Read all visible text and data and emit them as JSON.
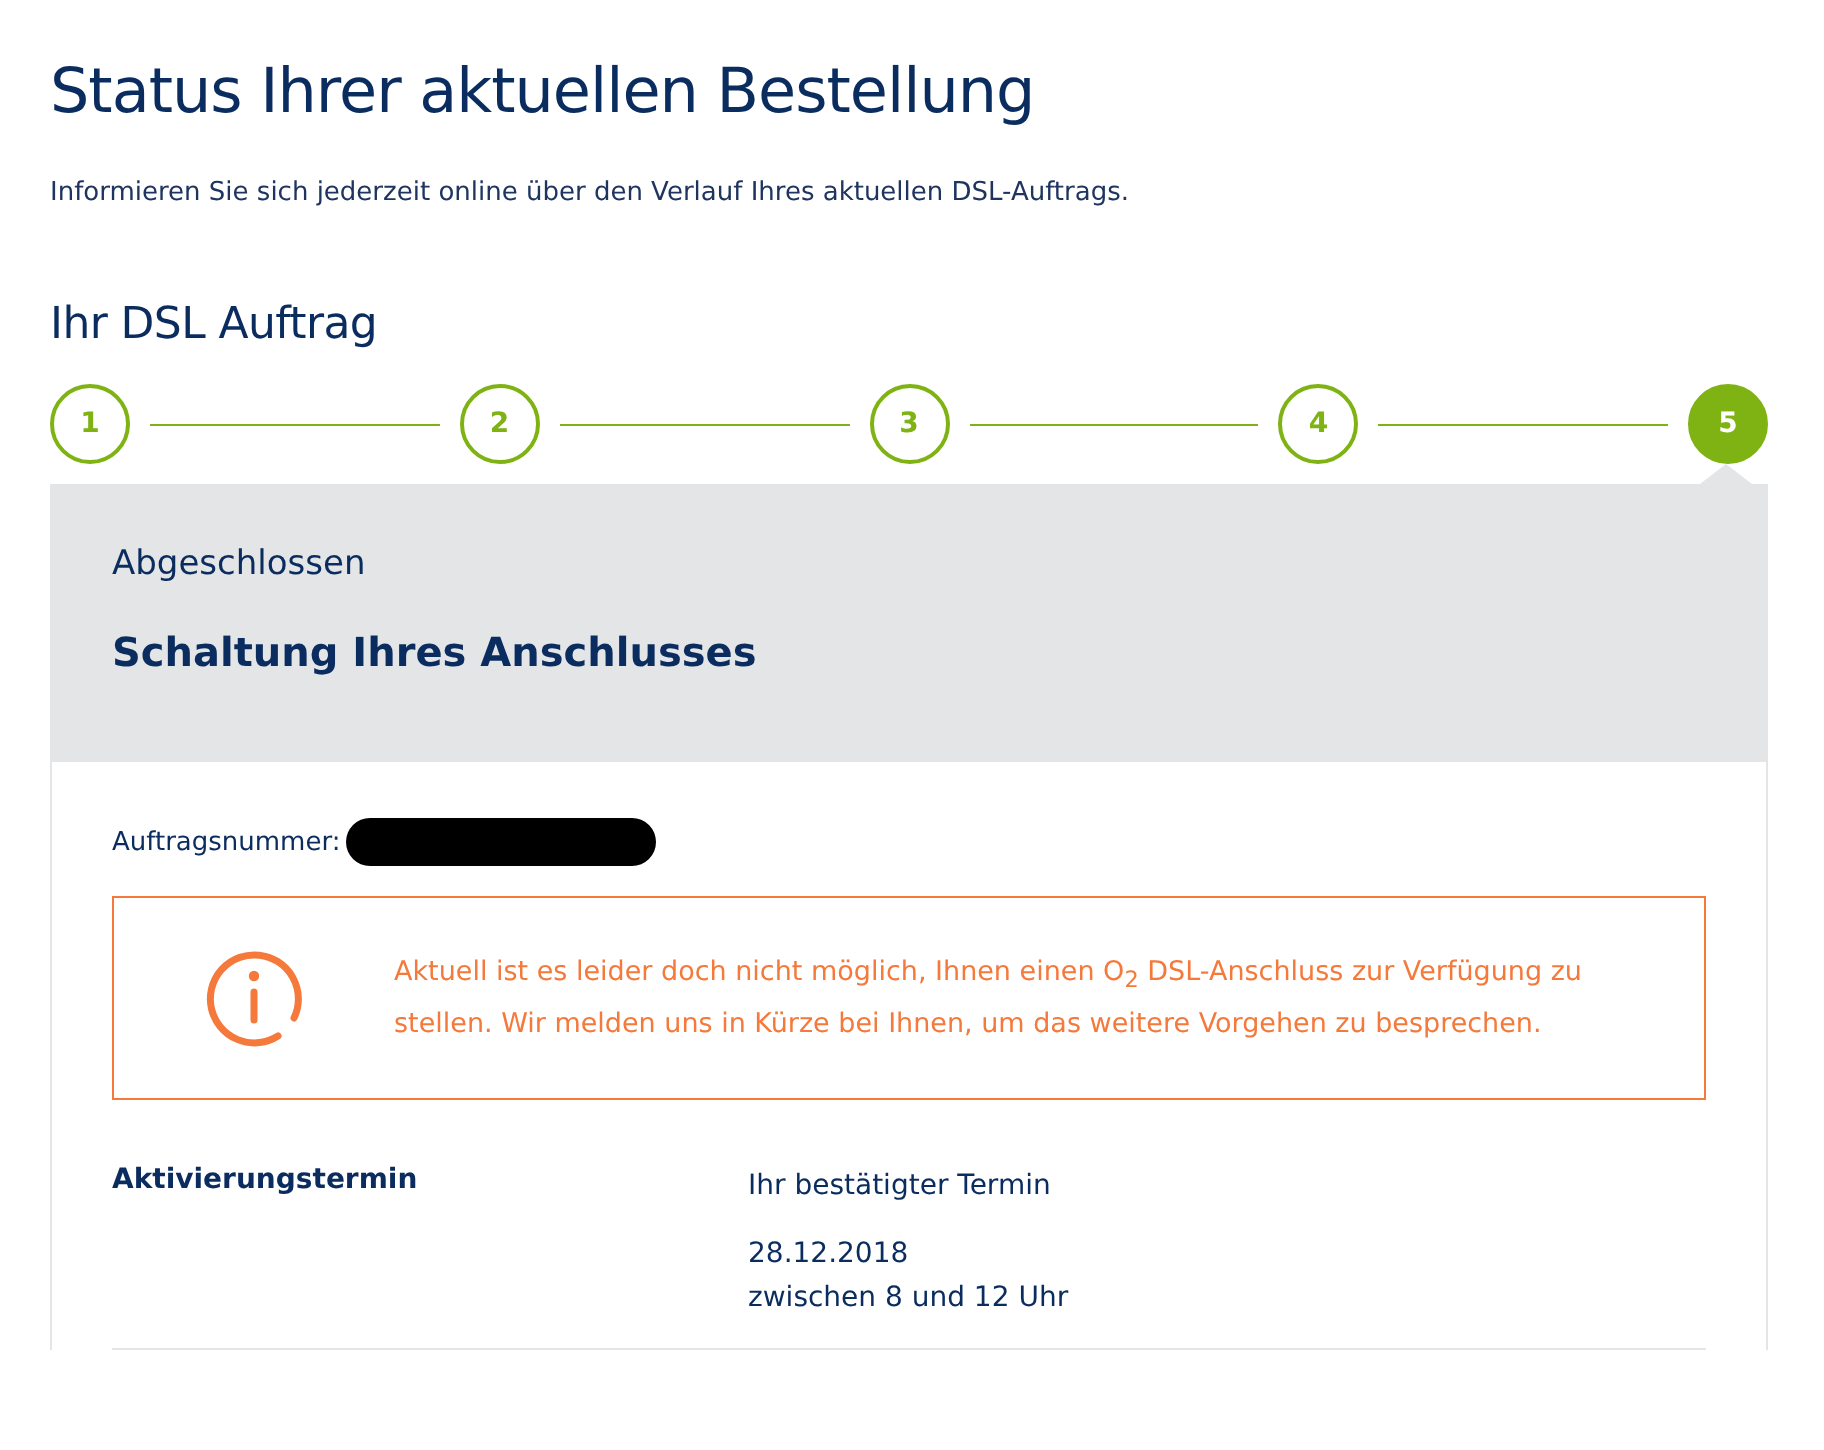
{
  "title": "Status Ihrer aktuellen Bestellung",
  "intro": "Informieren Sie sich jederzeit online über den Verlauf Ihres aktuellen DSL-Auftrags.",
  "section_title": "Ihr DSL Auftrag",
  "steps": [
    {
      "label": "1",
      "selected": false
    },
    {
      "label": "2",
      "selected": false
    },
    {
      "label": "3",
      "selected": false
    },
    {
      "label": "4",
      "selected": false
    },
    {
      "label": "5",
      "selected": true
    }
  ],
  "status": {
    "state": "Abgeschlossen",
    "title": "Schaltung Ihres Anschlusses"
  },
  "order_number_label": "Auftragsnummer:",
  "notice": "Aktuell ist es leider doch nicht möglich, Ihnen einen O$_{2}$ DSL-Anschluss zur Verfügung zu stellen. Wir melden uns in Kürze bei Ihnen, um das weitere Vorgehen zu besprechen.",
  "activation": {
    "label": "Aktivierungstermin",
    "caption": "Ihr bestätigter Termin",
    "date": "28.12.2018",
    "time": "zwischen 8 und 12 Uhr"
  }
}
